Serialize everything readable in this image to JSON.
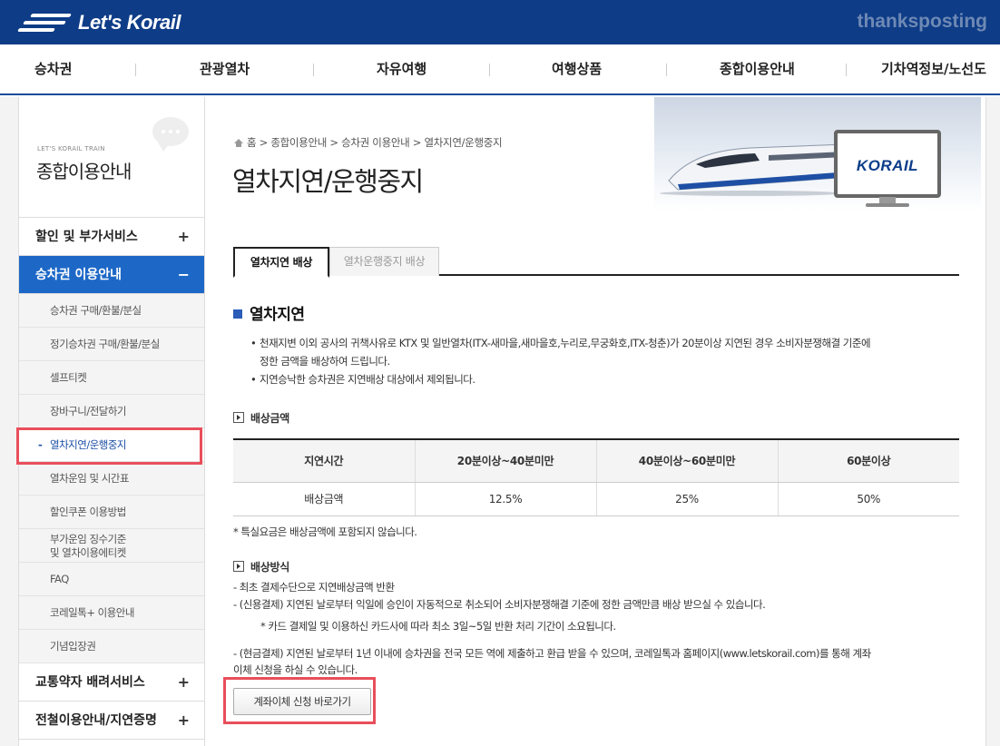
{
  "header": {
    "logo_text": "Let's Korail",
    "watermark": "thanksposting",
    "brand_color": "#0e3c87"
  },
  "gnb": {
    "items": [
      "승차권",
      "관광열차",
      "자유여행",
      "여행상품",
      "종합이용안내",
      "기차역정보/노선도"
    ]
  },
  "lnb": {
    "small_title": "LET'S KORAIL TRAIN",
    "title": "종합이용안내",
    "majors": [
      {
        "label": "할인 및 부가서비스",
        "sign": "+"
      },
      {
        "label": "승차권 이용안내",
        "sign": "−"
      },
      {
        "label": "교통약자 배려서비스",
        "sign": "+"
      },
      {
        "label": "전철이용안내/지연증명",
        "sign": "+"
      }
    ],
    "subs": [
      "승차권 구매/환불/분실",
      "정기승차권 구매/환불/분실",
      "셀프티켓",
      "장바구니/전달하기",
      "열차지연/운행중지",
      "열차운임 및 시간표",
      "할인쿠폰 이용방법",
      "부가운임 징수기준",
      "및 열차이용에티켓",
      "FAQ",
      "코레일톡+ 이용안내",
      "기념입장권"
    ],
    "active_color": "#1d68c7"
  },
  "content": {
    "breadcrumb": [
      "홈",
      "종합이용안내",
      "승차권 이용안내",
      "열차지연/운행중지"
    ],
    "page_title": "열차지연/운행중지",
    "hero_logo": "KORAIL",
    "tabs": [
      "열차지연 배상",
      "열차운행중지 배상"
    ],
    "section_title": "열차지연",
    "bullets": [
      "천재지변 이외 공사의 귀책사유로 KTX 및 일반열차(ITX-새마을,새마을호,누리로,무궁화호,ITX-청춘)가 20분이상 지연된 경우 소비자분쟁해결 기준에",
      "정한 금액을 배상하여 드립니다.",
      "지연승낙한 승차권은 지연배상 대상에서 제외됩니다."
    ],
    "sub1": "배상금액",
    "table": {
      "headers": [
        "지연시간",
        "20분이상~40분미만",
        "40분이상~60분미만",
        "60분이상"
      ],
      "row": [
        "배상금액",
        "12.5%",
        "25%",
        "50%"
      ]
    },
    "note1": "* 특실요금은 배상금액에 포함되지 않습니다.",
    "sub2": "배상방식",
    "methods": [
      "- 최초 결제수단으로 지연배상금액 반환",
      "- (신용결제) 지연된 날로부터 익일에 승인이 자동적으로 취소되어 소비자분쟁해결 기준에 정한 금액만큼 배상 받으실 수 있습니다.",
      "* 카드 결제일 및 이용하신 카드사에 따라 최소 3일~5일 반환 처리 기간이 소요됩니다.",
      "- (현금결제) 지연된 날로부터 1년 이내에 승차권을 전국 모든 역에 제출하고 환급 받을 수 있으며, 코레일톡과 홈페이지(www.letskorail.com)를 통해 계좌",
      "이체 신청을 하실 수 있습니다."
    ],
    "button_label": "계좌이체 신청 바로가기"
  },
  "highlight_color": "#e94e5b"
}
